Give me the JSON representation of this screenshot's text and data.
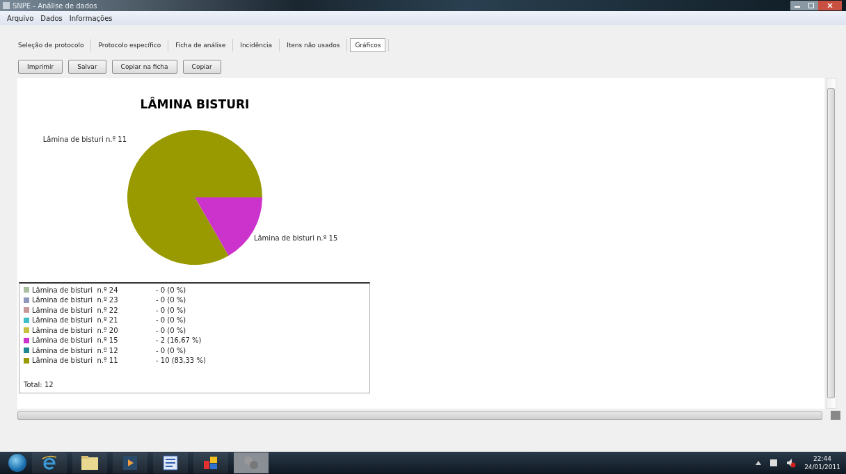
{
  "window": {
    "title": "SNPE - Análise de dados"
  },
  "menu": [
    {
      "label": "Arquivo"
    },
    {
      "label": "Dados"
    },
    {
      "label": "Informações"
    }
  ],
  "tabs": [
    {
      "label": "Seleção de protocolo",
      "selected": false
    },
    {
      "label": "Protocolo específico",
      "selected": false
    },
    {
      "label": "Ficha de análise",
      "selected": false
    },
    {
      "label": "Incidência",
      "selected": false
    },
    {
      "label": "Itens não usados",
      "selected": false
    },
    {
      "label": "Gráficos",
      "selected": true
    }
  ],
  "buttons": [
    "Imprimir",
    "Salvar",
    "Copiar na ficha",
    "Copiar"
  ],
  "chart": {
    "chart_data": {
      "type": "pie",
      "title": "LÂMINA BISTURI",
      "categories": [
        "Lâmina de bisturi  n.º 15",
        "Lâmina de bisturi  n.º 11"
      ],
      "values": [
        16.67,
        83.33
      ],
      "colors": [
        "#cc33cc",
        "#999900"
      ]
    }
  },
  "legend": {
    "items": [
      {
        "label": "Lâmina de bisturi  n.º 24",
        "value": "- 0 (0 %)",
        "color": "#a8c0a0"
      },
      {
        "label": "Lâmina de bisturi  n.º 23",
        "value": "- 0 (0 %)",
        "color": "#9098c0"
      },
      {
        "label": "Lâmina de bisturi  n.º 22",
        "value": "- 0 (0 %)",
        "color": "#c89898"
      },
      {
        "label": "Lâmina de bisturi  n.º 21",
        "value": "- 0 (0 %)",
        "color": "#40c0c8"
      },
      {
        "label": "Lâmina de bisturi  n.º 20",
        "value": "- 0 (0 %)",
        "color": "#c8c040"
      },
      {
        "label": "Lâmina de bisturi  n.º 15",
        "value": "- 2 (16,67 %)",
        "color": "#cc33cc"
      },
      {
        "label": "Lâmina de bisturi  n.º 12",
        "value": "- 0 (0 %)",
        "color": "#208890"
      },
      {
        "label": "Lâmina de bisturi  n.º 11",
        "value": "- 10 (83,33 %)",
        "color": "#999900"
      }
    ],
    "total": "Total: 12"
  },
  "taskbar": {
    "time": "22:44",
    "date": "24/01/2011"
  }
}
